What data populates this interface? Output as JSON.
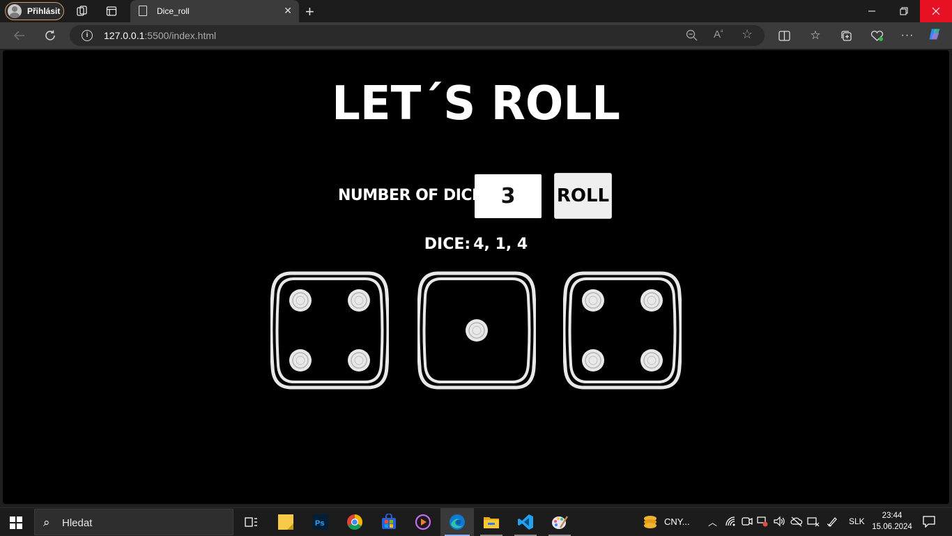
{
  "browser": {
    "profile_label": "Přihlásit",
    "tab_title": "Dice_roll",
    "url_host": "127.0.0.1",
    "url_rest": ":5500/index.html"
  },
  "page": {
    "headline": "LET´S ROLL",
    "number_label": "NUMBER OF DICE",
    "number_value": "3",
    "roll_label": "ROLL",
    "result_prefix": "DICE:",
    "result_values": "4, 1, 4",
    "dice": [
      4,
      1,
      4
    ]
  },
  "taskbar": {
    "search_placeholder": "Hledat",
    "widget_label": "CNY...",
    "language": "SLK",
    "time": "23:44",
    "date": "15.06.2024"
  },
  "colors": {
    "page_background": "#000000",
    "die_stroke": "#e8e8e8",
    "close_button": "#e81123",
    "profile_outline": "#d49a64"
  }
}
